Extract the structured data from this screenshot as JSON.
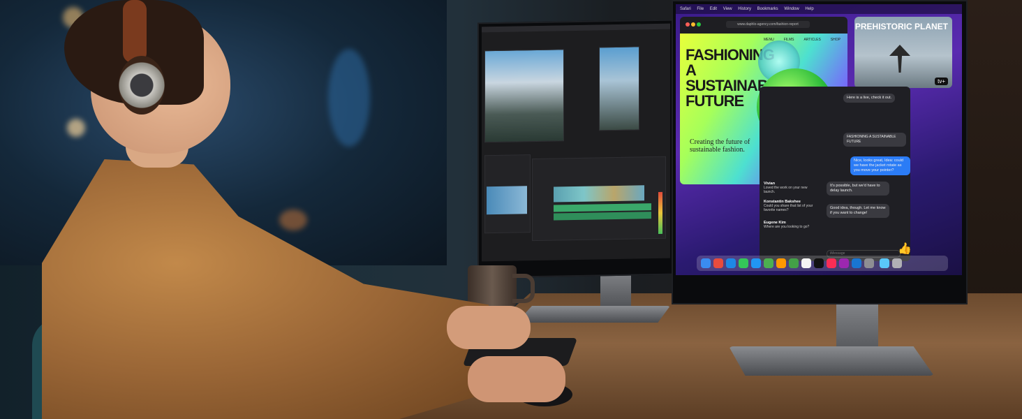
{
  "scene": {
    "description_tags": [
      "person-with-headphones",
      "dual-monitor-setup",
      "desk",
      "keyboard",
      "mouse",
      "mug"
    ]
  },
  "left_monitor": {
    "app": "video-editor",
    "icons": [
      "film-icon",
      "timeline-icon"
    ]
  },
  "right_monitor": {
    "menubar": [
      "Safari",
      "File",
      "Edit",
      "View",
      "History",
      "Bookmarks",
      "Window",
      "Help"
    ],
    "browser": {
      "url": "www.daphlo-agency.com/fashion-report",
      "nav": [
        "MENU",
        "FILMS",
        "ARTICLES",
        "SHOP"
      ],
      "hero_title": "FASHIONING A SUSTAINABLE FUTURE",
      "hero_subtitle": "Creating the future of sustainable fashion."
    },
    "video_tile": {
      "title": "PREHISTORIC PLANET",
      "badge": "tv+"
    },
    "messages": {
      "incoming_1": "Here is a live, check it out.",
      "link_caption": "FASHIONING A SUSTAINABLE FUTURE",
      "outgoing_1": "Nice, looks great, Idea: could we have the jacket rotate as you move your pointer?",
      "incoming_2": "It's possible, but we'd have to delay launch.",
      "incoming_3": "Good idea, though. Let me know if you want to change!",
      "composer_placeholder": "iMessage",
      "threads": [
        {
          "name": "Vivian",
          "preview": "Loved the work on your new launch."
        },
        {
          "name": "Konstantin Bakshee",
          "preview": "Could you share that list of your favorite names?"
        },
        {
          "name": "Eugene Kim",
          "preview": "Where are you looking to go?"
        }
      ]
    },
    "accent_colors": {
      "imessage_blue": "#2b7cf6",
      "wallpaper": "#5a2bb0"
    }
  }
}
